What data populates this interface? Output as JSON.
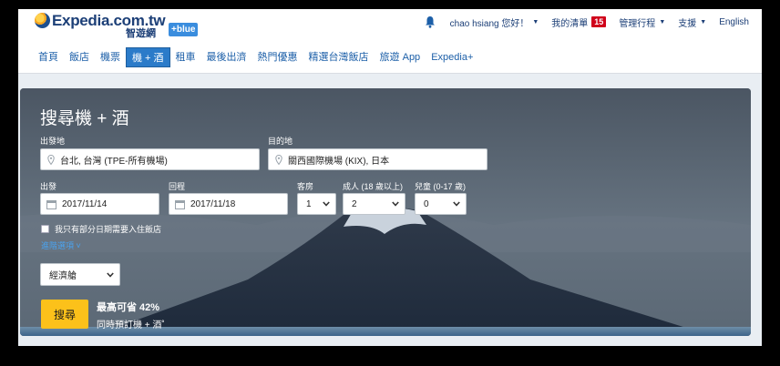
{
  "header": {
    "brand": "Expedia.com.tw",
    "brand_sub": "智遊網",
    "blue_badge": "+blue",
    "user": "chao hsiang 您好！",
    "my_list": "我的清單",
    "my_list_count": "15",
    "manage_trips": "管理行程",
    "support": "支援",
    "language": "English"
  },
  "nav": {
    "tabs": [
      {
        "label": "首頁"
      },
      {
        "label": "飯店"
      },
      {
        "label": "機票"
      },
      {
        "label": "機 + 酒"
      },
      {
        "label": "租車"
      },
      {
        "label": "最後出濟"
      },
      {
        "label": "熱門優惠"
      },
      {
        "label": "精選台灣飯店"
      },
      {
        "label": "旅遊 App"
      },
      {
        "label": "Expedia+"
      }
    ],
    "active_index": 3
  },
  "search": {
    "title": "搜尋機 + 酒",
    "origin_label": "出發地",
    "origin_value": "台北, 台灣 (TPE-所有機場)",
    "destination_label": "目的地",
    "destination_value": "關西國際機場 (KIX), 日本",
    "depart_label": "出發",
    "depart_value": "2017/11/14",
    "return_label": "回程",
    "return_value": "2017/11/18",
    "rooms_label": "客房",
    "rooms_value": "1",
    "adults_label": "成人 (18 歲以上)",
    "adults_value": "2",
    "children_label": "兒童 (0-17 歲)",
    "children_value": "0",
    "partial_hotel_label": "我只有部分日期需要入住飯店",
    "advanced_link": "進階選項 ˅",
    "cabin_value": "經濟艙",
    "search_button": "搜尋",
    "promo_line1": "最高可省 42%",
    "promo_line2": "同時預訂機 + 酒˚"
  },
  "colors": {
    "brand_navy": "#1c3f77",
    "active_tab": "#2b7bc9",
    "badge_red": "#d0021b",
    "search_yellow": "#fcc11a"
  },
  "icons": [
    "globe-icon",
    "bell-icon",
    "location-pin-icon",
    "calendar-icon",
    "chevron-down-icon",
    "checkbox-icon"
  ]
}
